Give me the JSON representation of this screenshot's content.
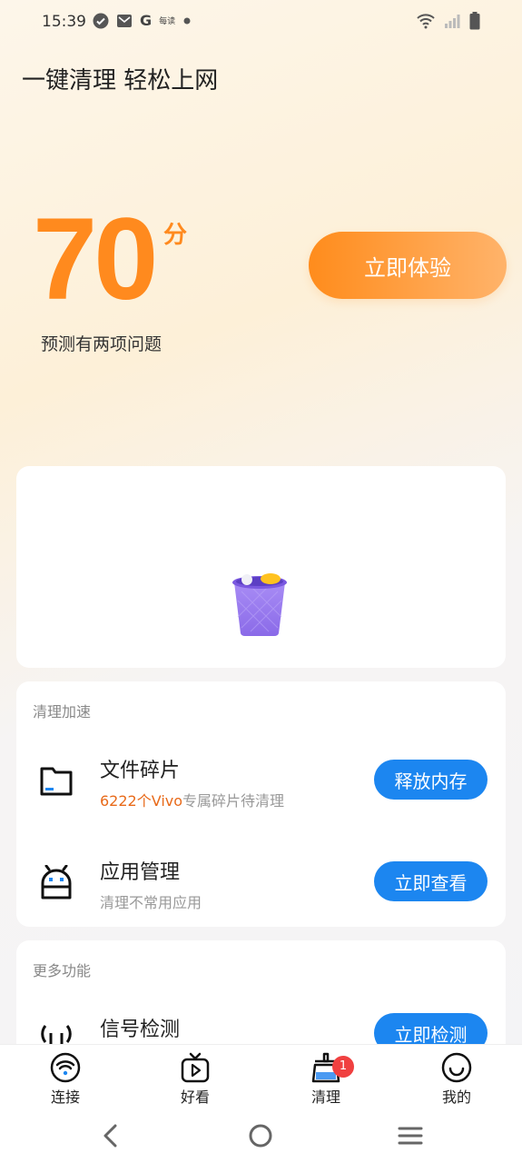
{
  "status_bar": {
    "time": "15:39",
    "icons_left": [
      "check-circle-icon",
      "mail-icon",
      "google-icon",
      "app-icon",
      "dot-icon"
    ],
    "google_letter": "G",
    "app_text": "每读",
    "icons_right": [
      "wifi-icon",
      "signal-icon",
      "battery-icon"
    ]
  },
  "header": {
    "title": "一键清理 轻松上网"
  },
  "score": {
    "value": "70",
    "unit": "分",
    "description": "预测有两项问题",
    "cta_label": "立即体验"
  },
  "cleanup": {
    "section_title": "清理加速",
    "items": [
      {
        "title": "文件碎片",
        "subtitle_highlight": "6222个Vivo",
        "subtitle_rest": "专属碎片待清理",
        "button": "释放内存",
        "icon": "folder-icon"
      },
      {
        "title": "应用管理",
        "subtitle": "清理不常用应用",
        "button": "立即查看",
        "icon": "android-icon"
      }
    ]
  },
  "more": {
    "section_title": "更多功能",
    "items": [
      {
        "title": "信号检测",
        "button": "立即检测",
        "icon": "router-icon"
      }
    ]
  },
  "tabs": [
    {
      "label": "连接",
      "icon": "wifi-icon"
    },
    {
      "label": "好看",
      "icon": "video-icon"
    },
    {
      "label": "清理",
      "icon": "broom-icon",
      "badge": "1"
    },
    {
      "label": "我的",
      "icon": "smile-icon"
    }
  ],
  "colors": {
    "accent_orange": "#ff8a1e",
    "button_blue": "#1c86f0",
    "badge_red": "#f04040"
  }
}
